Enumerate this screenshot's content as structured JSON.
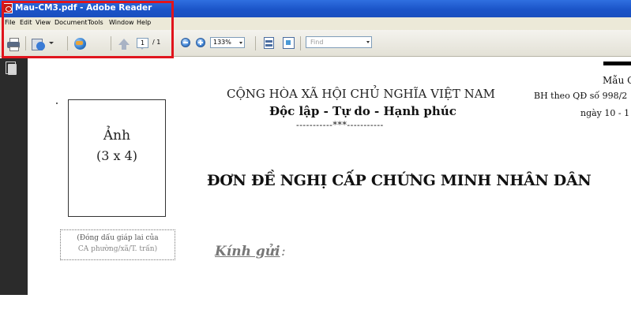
{
  "window": {
    "title": "Mau-CM3.pdf - Adobe Reader"
  },
  "menubar": {
    "items": [
      "File",
      "Edit",
      "View",
      "Document",
      "Tools",
      "Window",
      "Help"
    ]
  },
  "toolbar": {
    "page_current": "1",
    "page_total": "/ 1",
    "zoom": "133%",
    "find_placeholder": "Find",
    "icons": [
      "print-icon",
      "collaborate-icon",
      "globe-icon",
      "previous-page-icon",
      "next-page-icon",
      "zoom-out-icon",
      "zoom-in-icon",
      "fit-page-icon",
      "fit-width-icon"
    ]
  },
  "highlight_color": "#e0141c",
  "document": {
    "header_right_1": "Mẫu C",
    "header_right_2": "BH theo QĐ số 998/2",
    "header_right_3": "ngày 10 - 1",
    "national_title": "CỘNG HÒA XÃ HỘI CHỦ NGHĨA VIỆT NAM",
    "motto": "Độc lập - Tự do - Hạnh phúc",
    "separator": "-----------***-----------",
    "photo_label_1": "Ảnh",
    "photo_label_2": "(3 x 4)",
    "stamp_line_1": "(Đóng dấu giáp lai của",
    "stamp_line_2": "CA phường/xã/T. trấn)",
    "form_title": "ĐƠN ĐỀ NGHỊ CẤP CHỨNG MINH NHÂN DÂN",
    "addressee_label": "Kính gửi",
    "addressee_colon": " :"
  }
}
